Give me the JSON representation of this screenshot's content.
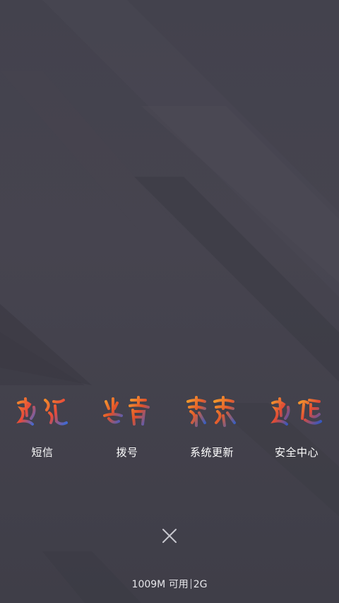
{
  "apps": [
    {
      "label": "短信",
      "icon": "calligraphy-icon-1"
    },
    {
      "label": "拨号",
      "icon": "calligraphy-icon-2"
    },
    {
      "label": "系统更新",
      "icon": "calligraphy-icon-3"
    },
    {
      "label": "安全中心",
      "icon": "calligraphy-icon-4"
    }
  ],
  "close_icon": "close-icon",
  "memory": {
    "available": "1009M 可用",
    "total": "2G"
  },
  "colors": {
    "background": "#45434f",
    "text": "#ffffff"
  }
}
